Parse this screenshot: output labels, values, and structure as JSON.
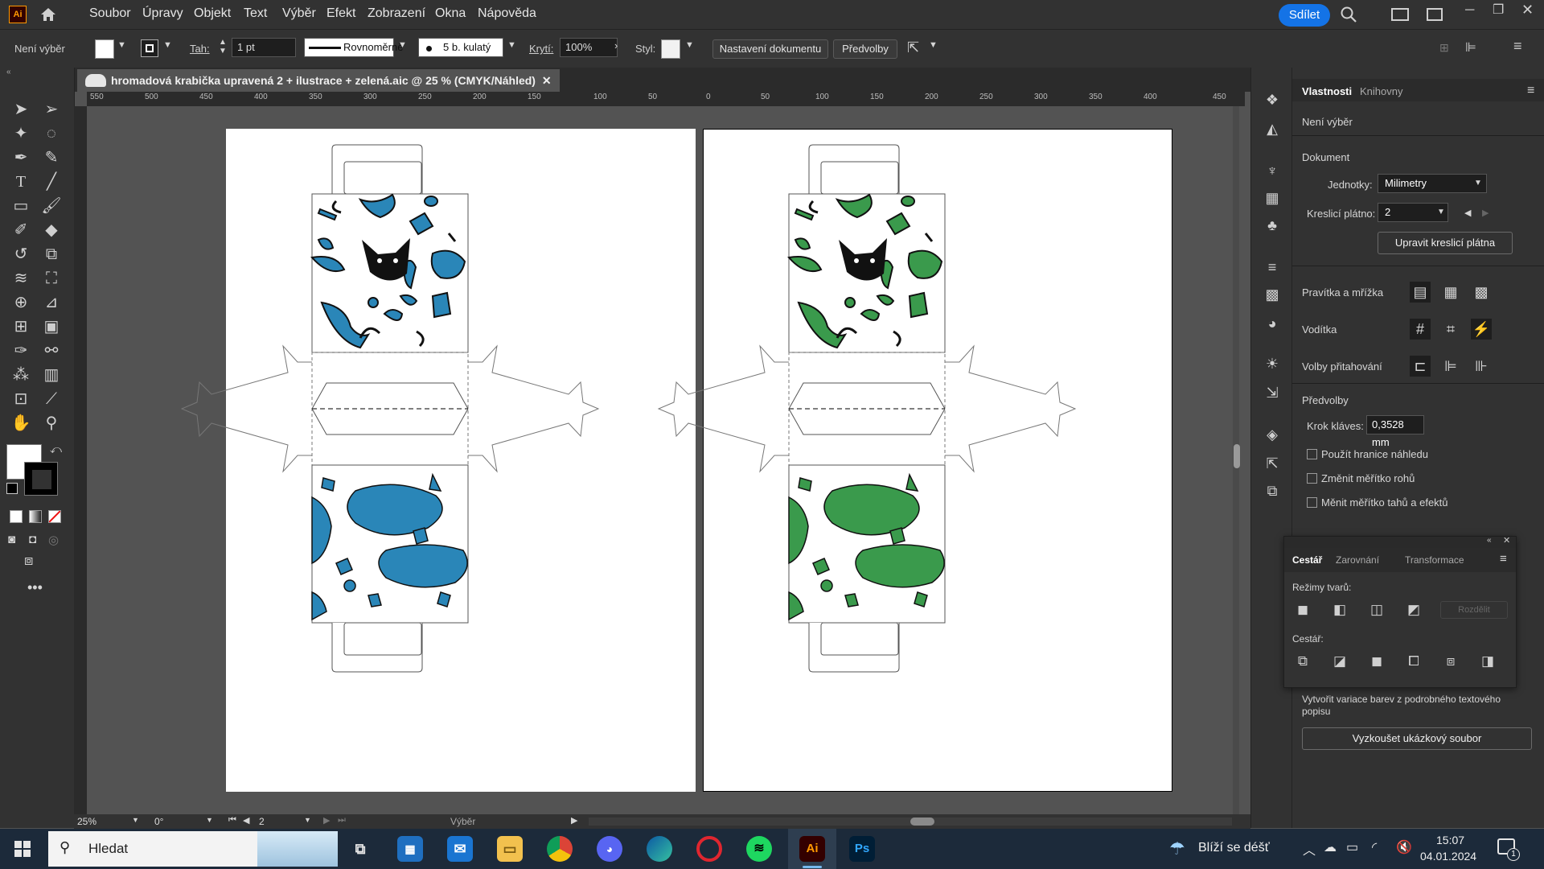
{
  "app": {
    "logo": "Ai"
  },
  "menu": [
    "Soubor",
    "Úpravy",
    "Objekt",
    "Text",
    "Výběr",
    "Efekt",
    "Zobrazení",
    "Okna",
    "Nápověda"
  ],
  "share_label": "Sdílet",
  "control": {
    "selection": "Není výběr",
    "stroke_label": "Tah:",
    "stroke_value": "1 pt",
    "stroke_style": "Rovnoměrně",
    "brush": "5 b. kulatý",
    "opacity_label": "Krytí:",
    "opacity_value": "100%",
    "style_label": "Styl:",
    "doc_setup": "Nastavení dokumentu",
    "prefs": "Předvolby"
  },
  "document_tab": "hromadová krabička upravená 2 + ilustrace + zelená.aic @ 25 % (CMYK/Náhled)",
  "ruler_ticks": [
    "550",
    "500",
    "450",
    "400",
    "350",
    "300",
    "250",
    "200",
    "150",
    "100",
    "50",
    "0",
    "50",
    "100",
    "150",
    "200",
    "250",
    "300",
    "350",
    "400",
    "450"
  ],
  "status": {
    "zoom": "25%",
    "rotation": "0°",
    "artboard": "2",
    "tool": "Výběr"
  },
  "properties": {
    "tab_properties": "Vlastnosti",
    "tab_libraries": "Knihovny",
    "no_selection": "Není výběr",
    "document_heading": "Dokument",
    "units_label": "Jednotky:",
    "units_value": "Milimetry",
    "artboard_label": "Kreslicí plátno:",
    "artboard_value": "2",
    "edit_artboards": "Upravit kreslicí plátna",
    "rulers_grid": "Pravítka a mřížka",
    "guides": "Vodítka",
    "snap_options": "Volby přitahování",
    "prefs_heading": "Předvolby",
    "keyboard_increment_label": "Krok kláves:",
    "keyboard_increment_value": "0,3528 mm",
    "use_preview_bounds": "Použít hranice náhledu",
    "scale_corners": "Změnit měřítko rohů",
    "scale_strokes": "Měnit měřítko tahů a efektů",
    "color_variations": "Vytvořit variace barev z podrobného textového popisu",
    "try_sample": "Vyzkoušet ukázkový soubor"
  },
  "pathfinder": {
    "tab_pathfinder": "Cestář",
    "tab_align": "Zarovnání",
    "tab_transform": "Transformace",
    "shape_modes": "Režimy tvarů:",
    "expand": "Rozdělit",
    "pathfinders": "Cestář:"
  },
  "taskbar": {
    "search": "Hledat",
    "weather": "Blíží se déšť",
    "time": "15:07",
    "date": "04.01.2024",
    "notifications": "1"
  },
  "colors": {
    "blue": "#2a86b8",
    "green": "#3a9a4c",
    "accent": "#1473e6"
  }
}
